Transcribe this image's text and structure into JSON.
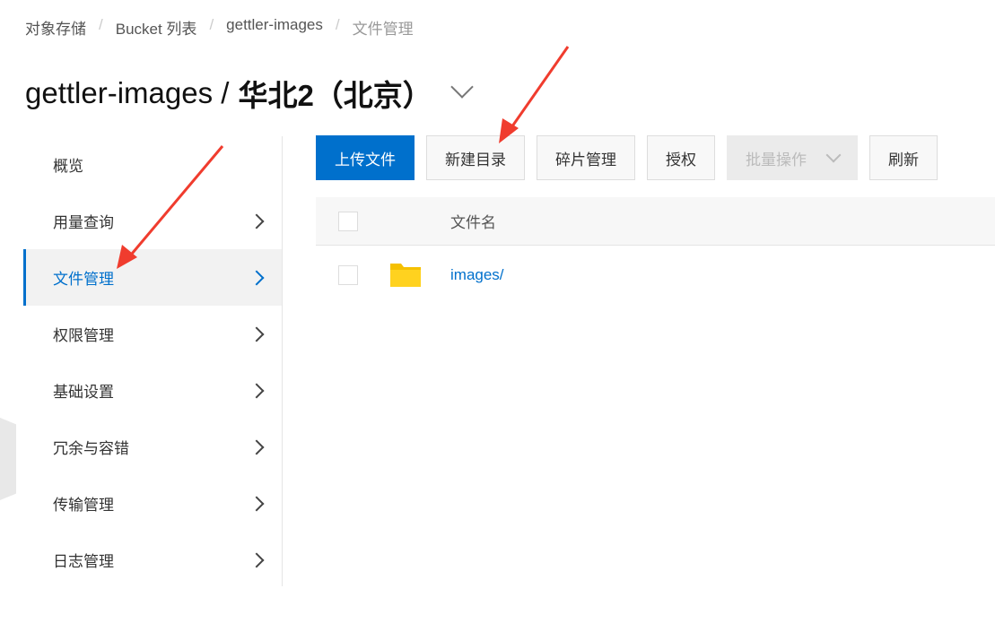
{
  "breadcrumb": [
    "对象存储",
    "Bucket 列表",
    "gettler-images",
    "文件管理"
  ],
  "title": {
    "bucket": "gettler-images /",
    "region": "华北2（北京）"
  },
  "sidebar": {
    "items": [
      {
        "label": "概览"
      },
      {
        "label": "用量查询"
      },
      {
        "label": "文件管理"
      },
      {
        "label": "权限管理"
      },
      {
        "label": "基础设置"
      },
      {
        "label": "冗余与容错"
      },
      {
        "label": "传输管理"
      },
      {
        "label": "日志管理"
      }
    ]
  },
  "toolbar": {
    "upload": "上传文件",
    "new_dir": "新建目录",
    "fragments": "碎片管理",
    "authorize": "授权",
    "batch": "批量操作",
    "refresh": "刷新"
  },
  "table": {
    "header": "文件名",
    "rows": [
      {
        "name": "images/"
      }
    ]
  },
  "colors": {
    "accent": "#0070cc",
    "annotation": "#f03c2e",
    "folder": "#ffcc00"
  }
}
